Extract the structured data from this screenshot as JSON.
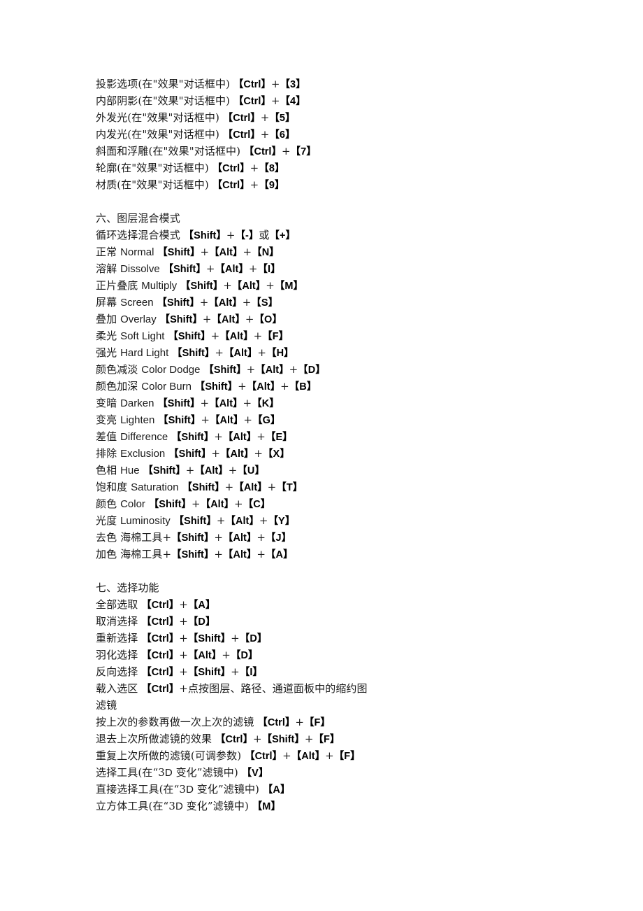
{
  "document": {
    "page_background": "#ffffff",
    "text_color": "#1a1a1a",
    "key_color": "#000000",
    "lines": [
      {
        "id": "l1",
        "type": "entry",
        "text": "投影选项(在\"效果\"对话框中)  【Ctrl】+【3】"
      },
      {
        "id": "l2",
        "type": "entry",
        "text": "内部阴影(在\"效果\"对话框中)  【Ctrl】+【4】"
      },
      {
        "id": "l3",
        "type": "entry",
        "text": "外发光(在\"效果\"对话框中)  【Ctrl】+【5】"
      },
      {
        "id": "l4",
        "type": "entry",
        "text": "内发光(在\"效果\"对话框中)  【Ctrl】+【6】"
      },
      {
        "id": "l5",
        "type": "entry",
        "text": "斜面和浮雕(在\"效果\"对话框中)  【Ctrl】+【7】"
      },
      {
        "id": "l6",
        "type": "entry",
        "text": "轮廓(在\"效果\"对话框中)  【Ctrl】+【8】"
      },
      {
        "id": "l7",
        "type": "entry",
        "text": "材质(在\"效果\"对话框中)  【Ctrl】+【9】"
      },
      {
        "id": "l8",
        "type": "blank",
        "text": ""
      },
      {
        "id": "l9",
        "type": "section",
        "text": "六、图层混合模式"
      },
      {
        "id": "l10",
        "type": "entry",
        "text": "循环选择混合模式 【Shift】+【-】或【+】"
      },
      {
        "id": "l11",
        "type": "entry",
        "text": "正常 Normal 【Shift】+【Alt】+【N】"
      },
      {
        "id": "l12",
        "type": "entry",
        "text": "溶解 Dissolve 【Shift】+【Alt】+【I】"
      },
      {
        "id": "l13",
        "type": "entry",
        "text": "正片叠底 Multiply 【Shift】+【Alt】+【M】"
      },
      {
        "id": "l14",
        "type": "entry",
        "text": "屏幕 Screen 【Shift】+【Alt】+【S】"
      },
      {
        "id": "l15",
        "type": "entry",
        "text": "叠加 Overlay 【Shift】+【Alt】+【O】"
      },
      {
        "id": "l16",
        "type": "entry",
        "text": "柔光 Soft Light 【Shift】+【Alt】+【F】"
      },
      {
        "id": "l17",
        "type": "entry",
        "text": "强光 Hard Light 【Shift】+【Alt】+【H】"
      },
      {
        "id": "l18",
        "type": "entry",
        "text": "颜色减淡 Color Dodge 【Shift】+【Alt】+【D】"
      },
      {
        "id": "l19",
        "type": "entry",
        "text": "颜色加深 Color Burn 【Shift】+【Alt】+【B】"
      },
      {
        "id": "l20",
        "type": "entry",
        "text": "变暗 Darken 【Shift】+【Alt】+【K】"
      },
      {
        "id": "l21",
        "type": "entry",
        "text": "变亮 Lighten 【Shift】+【Alt】+【G】"
      },
      {
        "id": "l22",
        "type": "entry",
        "text": "差值 Difference 【Shift】+【Alt】+【E】"
      },
      {
        "id": "l23",
        "type": "entry",
        "text": "排除 Exclusion 【Shift】+【Alt】+【X】"
      },
      {
        "id": "l24",
        "type": "entry",
        "text": "色相 Hue 【Shift】+【Alt】+【U】"
      },
      {
        "id": "l25",
        "type": "entry",
        "text": "饱和度 Saturation 【Shift】+【Alt】+【T】"
      },
      {
        "id": "l26",
        "type": "entry",
        "text": "颜色 Color 【Shift】+【Alt】+【C】"
      },
      {
        "id": "l27",
        "type": "entry",
        "text": "光度 Luminosity 【Shift】+【Alt】+【Y】"
      },
      {
        "id": "l28",
        "type": "entry",
        "text": "去色 海棉工具+【Shift】+【Alt】+【J】"
      },
      {
        "id": "l29",
        "type": "entry",
        "text": "加色 海棉工具+【Shift】+【Alt】+【A】"
      },
      {
        "id": "l30",
        "type": "blank",
        "text": ""
      },
      {
        "id": "l31",
        "type": "section",
        "text": "七、选择功能"
      },
      {
        "id": "l32",
        "type": "entry",
        "text": "全部选取 【Ctrl】+【A】"
      },
      {
        "id": "l33",
        "type": "entry",
        "text": "取消选择 【Ctrl】+【D】"
      },
      {
        "id": "l34",
        "type": "entry",
        "text": "重新选择 【Ctrl】+【Shift】+【D】"
      },
      {
        "id": "l35",
        "type": "entry",
        "text": "羽化选择 【Ctrl】+【Alt】+【D】"
      },
      {
        "id": "l36",
        "type": "entry",
        "text": "反向选择 【Ctrl】+【Shift】+【I】"
      },
      {
        "id": "l37",
        "type": "entry",
        "text": "载入选区 【Ctrl】+点按图层、路径、通道面板中的缩约图"
      },
      {
        "id": "l38",
        "type": "section",
        "text": "滤镜"
      },
      {
        "id": "l39",
        "type": "entry",
        "text": "按上次的参数再做一次上次的滤镜 【Ctrl】+【F】"
      },
      {
        "id": "l40",
        "type": "entry",
        "text": "退去上次所做滤镜的效果 【Ctrl】+【Shift】+【F】"
      },
      {
        "id": "l41",
        "type": "entry",
        "text": "重复上次所做的滤镜(可调参数) 【Ctrl】+【Alt】+【F】"
      },
      {
        "id": "l42",
        "type": "entry",
        "text": "选择工具(在“3D 变化”滤镜中) 【V】"
      },
      {
        "id": "l43",
        "type": "entry",
        "text": "直接选择工具(在“3D 变化”滤镜中) 【A】"
      },
      {
        "id": "l44",
        "type": "entry",
        "text": "立方体工具(在“3D 变化”滤镜中) 【M】"
      }
    ]
  }
}
